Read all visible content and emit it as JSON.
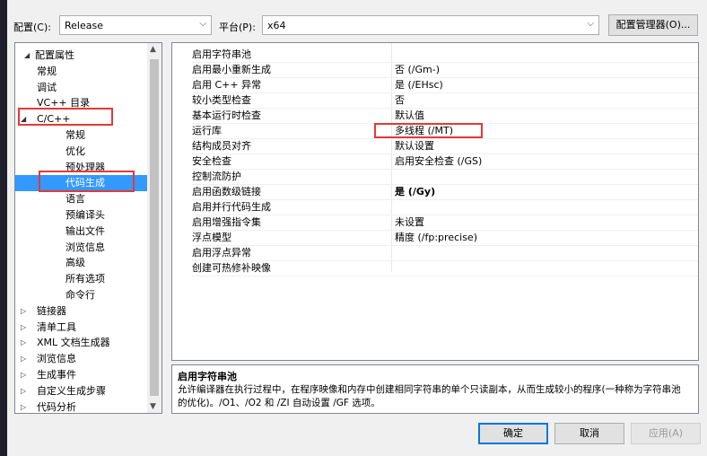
{
  "toolbar": {
    "config_label": "配置(C):",
    "config_value": "Release",
    "platform_label": "平台(P):",
    "platform_value": "x64",
    "config_manager_button": "配置管理器(O)..."
  },
  "tree": {
    "items": [
      {
        "label": "配置属性",
        "expander": "◢",
        "level": 0
      },
      {
        "label": "常规",
        "level": 1
      },
      {
        "label": "调试",
        "level": 1
      },
      {
        "label": "VC++ 目录",
        "level": 1
      },
      {
        "label": "C/C++",
        "expander": "◢",
        "level": 1
      },
      {
        "label": "常规",
        "level": 2
      },
      {
        "label": "优化",
        "level": 2
      },
      {
        "label": "预处理器",
        "level": 2
      },
      {
        "label": "代码生成",
        "level": 2,
        "selected": true
      },
      {
        "label": "语言",
        "level": 2
      },
      {
        "label": "预编译头",
        "level": 2
      },
      {
        "label": "输出文件",
        "level": 2
      },
      {
        "label": "浏览信息",
        "level": 2
      },
      {
        "label": "高级",
        "level": 2
      },
      {
        "label": "所有选项",
        "level": 2
      },
      {
        "label": "命令行",
        "level": 2
      },
      {
        "label": "链接器",
        "expander": "▷",
        "level": 1
      },
      {
        "label": "清单工具",
        "expander": "▷",
        "level": 1
      },
      {
        "label": "XML 文档生成器",
        "expander": "▷",
        "level": 1
      },
      {
        "label": "浏览信息",
        "expander": "▷",
        "level": 1
      },
      {
        "label": "生成事件",
        "expander": "▷",
        "level": 1
      },
      {
        "label": "自定义生成步骤",
        "expander": "▷",
        "level": 1
      },
      {
        "label": "代码分析",
        "expander": "▷",
        "level": 1
      }
    ]
  },
  "properties": [
    {
      "name": "启用字符串池",
      "value": ""
    },
    {
      "name": "启用最小重新生成",
      "value": "否 (/Gm-)"
    },
    {
      "name": "启用 C++ 异常",
      "value": "是 (/EHsc)"
    },
    {
      "name": "较小类型检查",
      "value": "否"
    },
    {
      "name": "基本运行时检查",
      "value": "默认值"
    },
    {
      "name": "运行库",
      "value": "多线程 (/MT)"
    },
    {
      "name": "结构成员对齐",
      "value": "默认设置"
    },
    {
      "name": "安全检查",
      "value": "启用安全检查 (/GS)"
    },
    {
      "name": "控制流防护",
      "value": ""
    },
    {
      "name": "启用函数级链接",
      "value": "是 (/Gy)",
      "bold": true
    },
    {
      "name": "启用并行代码生成",
      "value": ""
    },
    {
      "name": "启用增强指令集",
      "value": "未设置"
    },
    {
      "name": "浮点模型",
      "value": "精度 (/fp:precise)"
    },
    {
      "name": "启用浮点异常",
      "value": ""
    },
    {
      "name": "创建可热修补映像",
      "value": ""
    }
  ],
  "description": {
    "title": "启用字符串池",
    "body": "允许编译器在执行过程中，在程序映像和内存中创建相同字符串的单个只读副本，从而生成较小的程序(一种称为字符串池的优化)。/O1、/O2 和 /ZI 自动设置 /GF 选项。"
  },
  "buttons": {
    "ok": "确定",
    "cancel": "取消",
    "apply": "应用(A)"
  },
  "colors": {
    "selection": "#3399ff",
    "highlight_box": "#e53935",
    "primary_border": "#0078d7"
  }
}
